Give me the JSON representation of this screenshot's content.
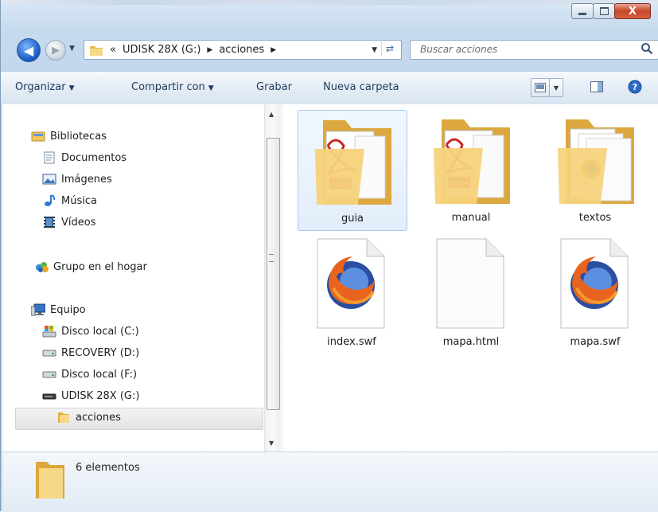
{
  "titlebar": {
    "minimize_label": "—",
    "close_label": "X"
  },
  "nav": {
    "breadcrumb": [
      "«",
      "UDISK 28X (G:)",
      "acciones"
    ],
    "search_placeholder": "Buscar acciones"
  },
  "commands": {
    "organize": "Organizar",
    "share": "Compartir con",
    "burn": "Grabar",
    "new_folder": "Nueva carpeta"
  },
  "sidebar": {
    "libraries": {
      "label": "Bibliotecas",
      "icon": "libraries-icon"
    },
    "library_items": [
      {
        "label": "Documentos",
        "icon": "documents-icon"
      },
      {
        "label": "Imágenes",
        "icon": "pictures-icon"
      },
      {
        "label": "Música",
        "icon": "music-icon"
      },
      {
        "label": "Vídeos",
        "icon": "videos-icon"
      }
    ],
    "homegroup": {
      "label": "Grupo en el hogar",
      "icon": "homegroup-icon"
    },
    "computer": {
      "label": "Equipo",
      "icon": "computer-icon"
    },
    "drives": [
      {
        "label": "Disco local (C:)",
        "icon": "system-drive-icon"
      },
      {
        "label": "RECOVERY (D:)",
        "icon": "drive-icon"
      },
      {
        "label": "Disco local (F:)",
        "icon": "drive-icon"
      },
      {
        "label": "UDISK 28X (G:)",
        "icon": "usb-drive-icon"
      }
    ],
    "current_folder": {
      "label": "acciones",
      "icon": "folder-icon"
    }
  },
  "files": [
    {
      "name": "guia",
      "type": "folder-pdf",
      "selected": true
    },
    {
      "name": "manual",
      "type": "folder-pdf",
      "selected": false
    },
    {
      "name": "textos",
      "type": "folder-docs",
      "selected": false
    },
    {
      "name": "index.swf",
      "type": "firefox-file",
      "selected": false
    },
    {
      "name": "mapa.html",
      "type": "blank-file",
      "selected": false
    },
    {
      "name": "mapa.swf",
      "type": "firefox-file",
      "selected": false
    }
  ],
  "details": {
    "count_text": "6 elementos"
  },
  "colors": {
    "accent": "#1f63c9",
    "folder": "#f3d27a",
    "pdf_red": "#c62828"
  }
}
